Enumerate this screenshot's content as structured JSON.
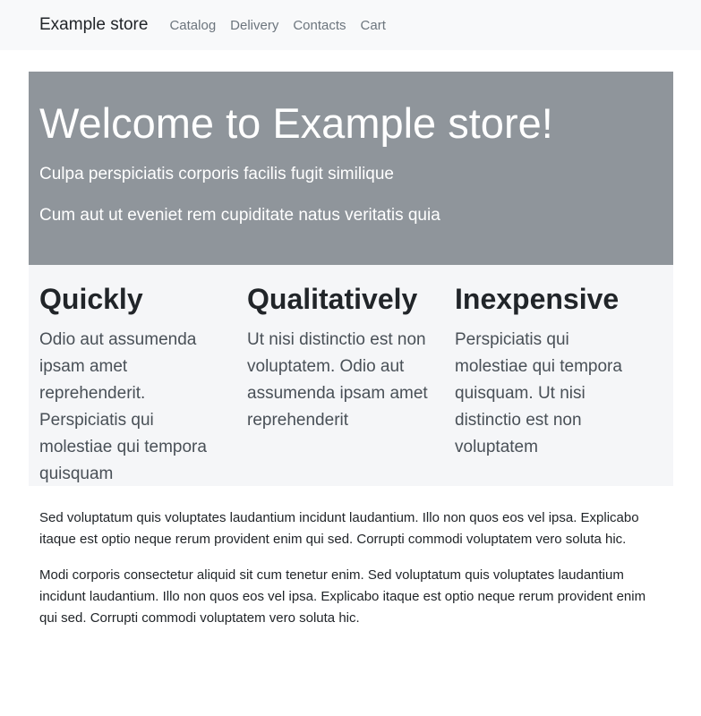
{
  "navbar": {
    "brand": "Example store",
    "links": [
      "Catalog",
      "Delivery",
      "Contacts",
      "Cart"
    ]
  },
  "jumbotron": {
    "title": "Welcome to Example store!",
    "lines": [
      "Culpa perspiciatis corporis facilis fugit similique",
      "Cum aut ut eveniet rem cupiditate natus veritatis quia"
    ]
  },
  "features": [
    {
      "title": "Quickly",
      "text": "Odio aut assumenda ipsam amet reprehenderit. Perspiciatis qui molestiae qui tempora quisquam"
    },
    {
      "title": "Qualitatively",
      "text": "Ut nisi distinctio est non voluptatem. Odio aut assumenda ipsam amet reprehenderit"
    },
    {
      "title": "Inexpensive",
      "text": "Perspiciatis qui molestiae qui tempora quisquam. Ut nisi distinctio est non voluptatem"
    }
  ],
  "content": {
    "paragraphs": [
      "Sed voluptatum quis voluptates laudantium incidunt laudantium. Illo non quos eos vel ipsa. Explicabo itaque est optio neque rerum provident enim qui sed. Corrupti commodi voluptatem vero soluta hic.",
      "Modi corporis consectetur aliquid sit cum tenetur enim. Sed voluptatum quis voluptates laudantium incidunt laudantium. Illo non quos eos vel ipsa. Explicabo itaque est optio neque rerum provident enim qui sed. Corrupti commodi voluptatem vero soluta hic."
    ]
  },
  "colors": {
    "navbar_bg": "#f8f9fa",
    "jumbotron_bg": "#8f959b",
    "features_bg": "#f5f6f8",
    "nav_link": "#6c757d"
  }
}
